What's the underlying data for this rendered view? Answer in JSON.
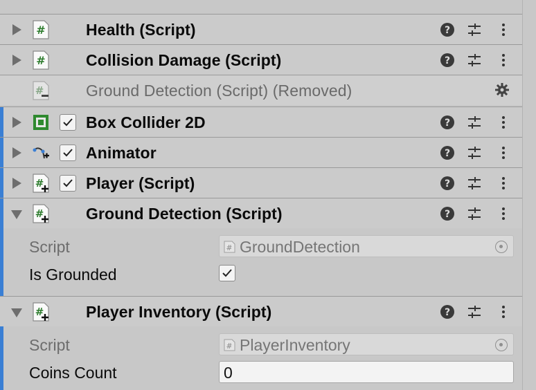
{
  "components": [
    {
      "title": "Health (Script)",
      "icon": "script-icon",
      "state": "collapsed",
      "has_checkbox": false
    },
    {
      "title": "Collision Damage (Script)",
      "icon": "script-icon",
      "state": "collapsed",
      "has_checkbox": false
    },
    {
      "title": "Ground Detection (Script) (Removed)",
      "icon": "script-removed-icon",
      "state": "removed",
      "has_checkbox": false
    },
    {
      "title": "Box Collider 2D",
      "icon": "box-collider-icon",
      "state": "collapsed",
      "has_checkbox": true,
      "checked": true
    },
    {
      "title": "Animator",
      "icon": "animator-icon",
      "state": "collapsed",
      "has_checkbox": true,
      "checked": true
    },
    {
      "title": "Player (Script)",
      "icon": "script-added-icon",
      "state": "collapsed",
      "has_checkbox": true,
      "checked": true
    },
    {
      "title": "Ground Detection (Script)",
      "icon": "script-added-icon",
      "state": "expanded",
      "has_checkbox": false
    },
    {
      "title": "Player Inventory (Script)",
      "icon": "script-added-icon",
      "state": "expanded",
      "has_checkbox": false
    }
  ],
  "ground_detection": {
    "script_label": "Script",
    "script_value": "GroundDetection",
    "is_grounded_label": "Is Grounded",
    "is_grounded": true
  },
  "player_inventory": {
    "script_label": "Script",
    "script_value": "PlayerInventory",
    "coins_count_label": "Coins Count",
    "coins_count": "0"
  },
  "colors": {
    "header_bg": "#cbcbcb",
    "accent_blue": "#3a7fd4",
    "script_icon_green": "#2f7d2f",
    "disabled_text": "#6d6d6d"
  }
}
